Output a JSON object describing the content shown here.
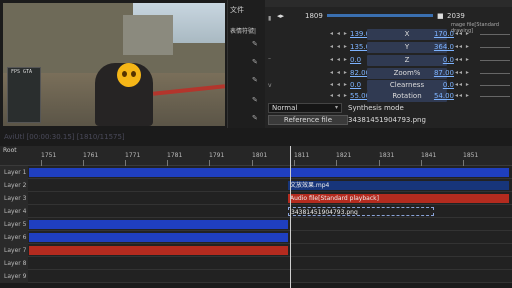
{
  "preview": {
    "hud_text": "FPS  GTA"
  },
  "midpanel": {
    "menu_label": "文件",
    "selection_label": "表情符號|",
    "pin_icon": "pin-icon"
  },
  "props": {
    "frame_start": "1809",
    "frame_end": "2039",
    "image_file_label": "mage file[Standard drawing]",
    "rows": [
      {
        "name": "X",
        "left": "139.0",
        "right": "170.0"
      },
      {
        "name": "Y",
        "left": "135.0",
        "right": "364.0"
      },
      {
        "name": "Z",
        "left": "0.0",
        "right": "0.0"
      },
      {
        "name": "Zoom%",
        "left": "82.00",
        "right": "87.00"
      },
      {
        "name": "Clearness",
        "left": "0.0",
        "right": "0.0"
      },
      {
        "name": "Rotation",
        "left": "55.00",
        "right": "54.00"
      }
    ],
    "blend_mode": "Normal",
    "synthesis_label": "Synthesis mode",
    "reference_button": "Reference file",
    "reference_filename": "34381451904793.png"
  },
  "timeline": {
    "title": "AviUtl [00:00:30.15] [1810/11575]",
    "root_label": "Root",
    "ticks": [
      "1751",
      "1761",
      "1771",
      "1781",
      "1791",
      "1801",
      "1811",
      "1821",
      "1831",
      "1841",
      "1851"
    ],
    "layers": [
      "Layer 1",
      "Layer 2",
      "Layer 3",
      "Layer 4",
      "Layer 5",
      "Layer 6",
      "Layer 7",
      "Layer 8",
      "Layer 9"
    ],
    "objects": {
      "layer2_label": "文放效果.mp4",
      "layer3_label": "Audio file[Standard playback]",
      "layer4_label": "34381451904793.png"
    }
  },
  "colors": {
    "object_blue": "#1f3fbf",
    "object_red": "#b42b1f",
    "value_link": "#7db3ff"
  }
}
